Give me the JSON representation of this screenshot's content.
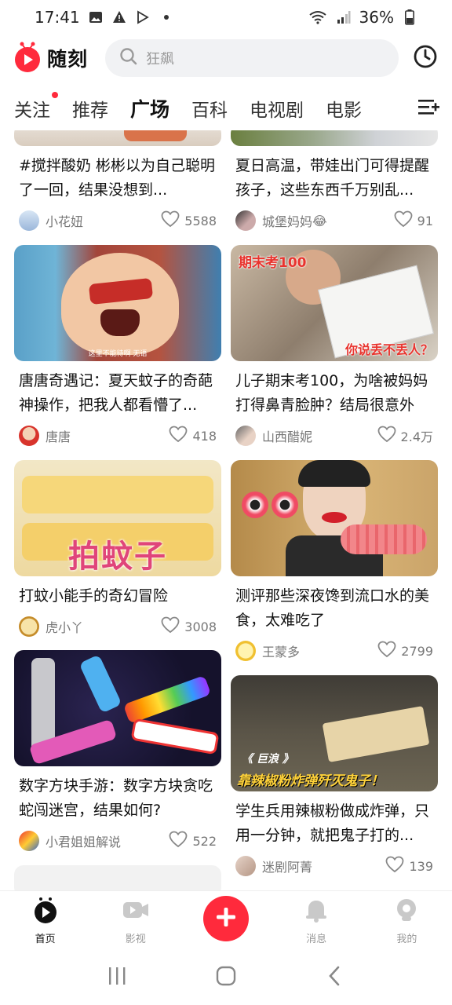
{
  "status": {
    "time": "17:41",
    "battery": "36%"
  },
  "header": {
    "app_name": "随刻",
    "search_placeholder": "狂飙"
  },
  "tabs": [
    {
      "label": "关注",
      "has_dot": true
    },
    {
      "label": "推荐"
    },
    {
      "label": "广场",
      "active": true
    },
    {
      "label": "百科"
    },
    {
      "label": "电视剧"
    },
    {
      "label": "电影"
    }
  ],
  "feed": {
    "left": [
      {
        "title": "#搅拌酸奶 彬彬以为自己聪明了一回，结果没想到...",
        "author": "小花妞",
        "likes": "5588"
      },
      {
        "title": "唐唐奇遇记：夏天蚊子的奇葩神操作，把我人都看懵了...",
        "author": "唐唐",
        "likes": "418",
        "caption": "这里不能待啊 无语"
      },
      {
        "title": "打蚊小能手的奇幻冒险",
        "author": "虎小丫",
        "likes": "3008",
        "overlay": "拍蚊子"
      },
      {
        "title": "数字方块手游：数字方块贪吃蛇闯迷宫，结果如何?",
        "author": "小君姐姐解说",
        "likes": "522"
      }
    ],
    "right": [
      {
        "title": "夏日高温，带娃出门可得提醒孩子，这些东西千万别乱...",
        "author": "城堡妈妈",
        "author_emoji": "😂",
        "likes": "91"
      },
      {
        "title": "儿子期末考100，为啥被妈妈打得鼻青脸肿？结局很意外",
        "author": "山西醋妮",
        "likes": "2.4万",
        "overlay_top": "期末考100",
        "overlay_bottom": "你说丢不丢人？"
      },
      {
        "title": "测评那些深夜馋到流口水的美食，太难吃了",
        "author": "王蒙多",
        "likes": "2799"
      },
      {
        "title": "学生兵用辣椒粉做成炸弹，只用一分钟，就把鬼子打的...",
        "author": "迷剧阿菁",
        "likes": "139",
        "overlay_tag": "《 巨浪 》",
        "overlay": "靠辣椒粉炸弹歼灭鬼子！"
      }
    ]
  },
  "bottom_nav": [
    {
      "label": "首页",
      "active": true
    },
    {
      "label": "影视"
    },
    {
      "label": ""
    },
    {
      "label": "消息"
    },
    {
      "label": "我的"
    }
  ],
  "colors": {
    "brand": "#ff2a3c",
    "text": "#111111",
    "muted": "#777777"
  }
}
